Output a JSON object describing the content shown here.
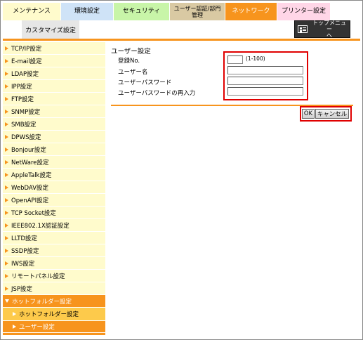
{
  "tabs": [
    {
      "label": "メンテナンス",
      "bg": "#fffbcc"
    },
    {
      "label": "環境設定",
      "bg": "#cfe3f7"
    },
    {
      "label": "セキュリティ",
      "bg": "#c8f5a8"
    },
    {
      "label": "ユーザー認証/部門管理",
      "line1": "ユーザー認証/部門",
      "line2": "管理",
      "bg": "#d9c9a3"
    },
    {
      "label": "ネットワーク",
      "bg": "#f7941d",
      "active": true
    },
    {
      "label": "プリンター設定",
      "bg": "#ffd6e7"
    }
  ],
  "sub_tab": "カスタマイズ設定",
  "top_menu": {
    "line1": "トップメニュー",
    "line2": "へ",
    "icon": "menu-list-icon"
  },
  "sidebar": {
    "items": [
      "TCP/IP設定",
      "E-mail設定",
      "LDAP設定",
      "IPP設定",
      "FTP設定",
      "SNMP設定",
      "SMB設定",
      "DPWS設定",
      "Bonjour設定",
      "NetWare設定",
      "AppleTalk設定",
      "WebDAV設定",
      "OpenAPI設定",
      "TCP Socket設定",
      "IEEE802.1X認証設定",
      "LLTD設定",
      "SSDP設定",
      "IWS設定",
      "リモートパネル設定",
      "JSP設定"
    ],
    "section_head": "ホットフォルダー設定",
    "sub_items": [
      "ホットフォルダー設定",
      "ユーザー設定"
    ]
  },
  "form": {
    "title": "ユーザー設定",
    "fields": [
      {
        "label": "登録No.",
        "value": "",
        "hint": "(1-100)"
      },
      {
        "label": "ユーザー名",
        "value": ""
      },
      {
        "label": "ユーザーパスワード",
        "value": ""
      },
      {
        "label": "ユーザーパスワードの再入力",
        "value": ""
      }
    ]
  },
  "buttons": {
    "ok": "OK",
    "cancel": "キャンセル"
  },
  "colors": {
    "accent": "#f7941d",
    "highlight": "#e00000"
  }
}
